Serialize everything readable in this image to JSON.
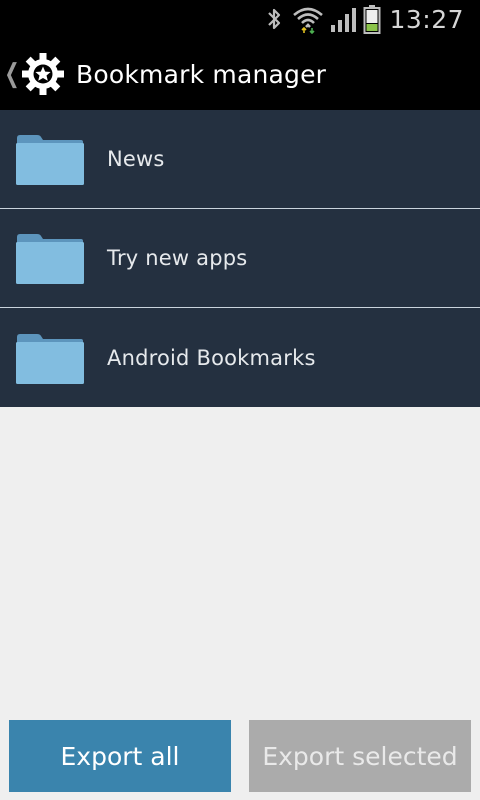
{
  "status_bar": {
    "time": "13:27",
    "icons": [
      "bluetooth-icon",
      "wifi-icon",
      "signal-icon",
      "battery-icon"
    ]
  },
  "action_bar": {
    "title": "Bookmark manager",
    "app_icon": "gear-star-icon",
    "up_icon": "chevron-left-icon"
  },
  "folders": [
    {
      "label": "News"
    },
    {
      "label": "Try new apps"
    },
    {
      "label": "Android Bookmarks"
    }
  ],
  "buttons": {
    "export_all": "Export all",
    "export_selected": "Export selected"
  },
  "colors": {
    "list_background": "#243040",
    "folder_icon": "#82bde0",
    "primary_button": "#3a84ad",
    "disabled_button": "#ababab",
    "battery_fill": "#8bc34a"
  }
}
